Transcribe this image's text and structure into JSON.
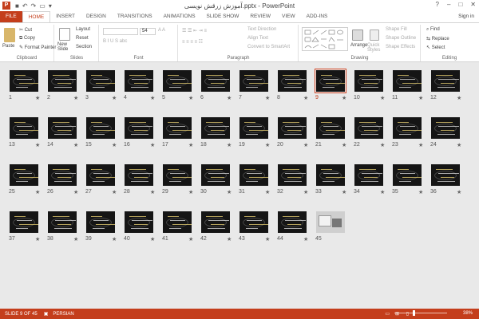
{
  "window": {
    "title": "آموزش زرقش نویسی.pptx - PowerPoint",
    "app_icon": "P",
    "controls": [
      "?",
      "–",
      "□",
      "✕"
    ]
  },
  "ribbon_tabs": [
    "FILE",
    "HOME",
    "INSERT",
    "DESIGN",
    "TRANSITIONS",
    "ANIMATIONS",
    "SLIDE SHOW",
    "REVIEW",
    "VIEW",
    "ADD-INS"
  ],
  "active_tab": "HOME",
  "signin": "Sign in",
  "clipboard": {
    "paste": "Paste",
    "cut": "Cut",
    "copy": "Copy",
    "format_painter": "Format Painter",
    "label": "Clipboard"
  },
  "slides_group": {
    "new_slide": "New Slide",
    "layout": "Layout",
    "reset": "Reset",
    "section": "Section",
    "label": "Slides"
  },
  "font_group": {
    "size": "54",
    "label": "Font"
  },
  "paragraph_group": {
    "text_direction": "Text Direction",
    "align_text": "Align Text",
    "convert": "Convert to SmartArt",
    "label": "Paragraph"
  },
  "drawing_group": {
    "arrange": "Arrange",
    "quick_styles": "Quick Styles",
    "shape_fill": "Shape Fill",
    "shape_outline": "Shape Outline",
    "shape_effects": "Shape Effects",
    "label": "Drawing"
  },
  "editing_group": {
    "find": "Find",
    "replace": "Replace",
    "select": "Select",
    "label": "Editing"
  },
  "slides": [
    "1",
    "2",
    "3",
    "4",
    "5",
    "6",
    "7",
    "8",
    "9",
    "10",
    "11",
    "12",
    "13",
    "14",
    "15",
    "16",
    "17",
    "18",
    "19",
    "20",
    "21",
    "22",
    "23",
    "24",
    "25",
    "26",
    "27",
    "28",
    "29",
    "30",
    "31",
    "32",
    "33",
    "34",
    "35",
    "36",
    "37",
    "38",
    "39",
    "40",
    "41",
    "42",
    "43",
    "44",
    "45"
  ],
  "selected_slide": "9",
  "status": {
    "slide_info": "SLIDE 9 OF 45",
    "language": "PERSIAN",
    "zoom": "38%"
  },
  "colors": {
    "accent": "#c43e1c"
  }
}
